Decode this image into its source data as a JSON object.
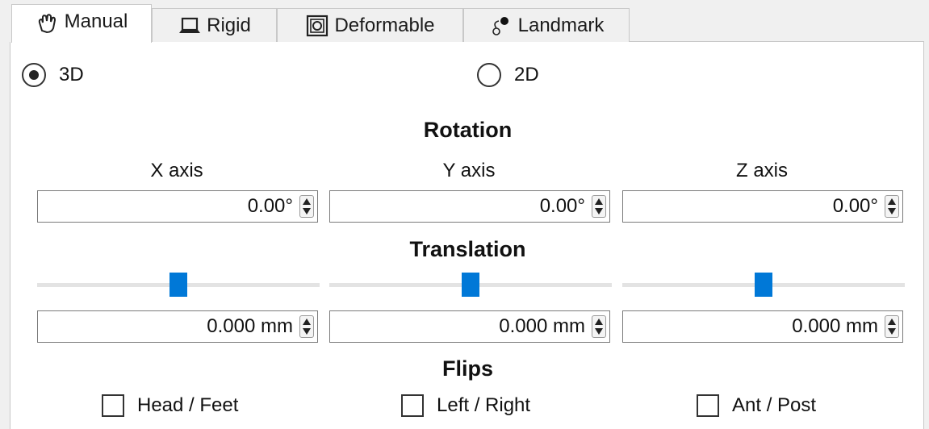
{
  "tabs": [
    {
      "label": "Manual",
      "icon": "hand-icon",
      "active": true
    },
    {
      "label": "Rigid",
      "icon": "laptop-icon",
      "active": false
    },
    {
      "label": "Deformable",
      "icon": "deformable-icon",
      "active": false
    },
    {
      "label": "Landmark",
      "icon": "landmark-icon",
      "active": false
    }
  ],
  "mode": {
    "options": [
      {
        "label": "3D",
        "selected": true
      },
      {
        "label": "2D",
        "selected": false
      }
    ]
  },
  "rotation": {
    "title": "Rotation",
    "axes": [
      {
        "label": "X axis",
        "value": "0.00°"
      },
      {
        "label": "Y axis",
        "value": "0.00°"
      },
      {
        "label": "Z axis",
        "value": "0.00°"
      }
    ]
  },
  "translation": {
    "title": "Translation",
    "sliders": [
      {
        "level": 0.5
      },
      {
        "level": 0.5
      },
      {
        "level": 0.5
      }
    ],
    "values": [
      "0.000 mm",
      "0.000 mm",
      "0.000 mm"
    ]
  },
  "flips": {
    "title": "Flips",
    "options": [
      {
        "label": "Head / Feet",
        "checked": false
      },
      {
        "label": "Left / Right",
        "checked": false
      },
      {
        "label": "Ant / Post",
        "checked": false
      }
    ]
  },
  "colors": {
    "accent": "#0078d7",
    "panel_bg": "#ffffff",
    "window_bg": "#f0f0f0"
  }
}
